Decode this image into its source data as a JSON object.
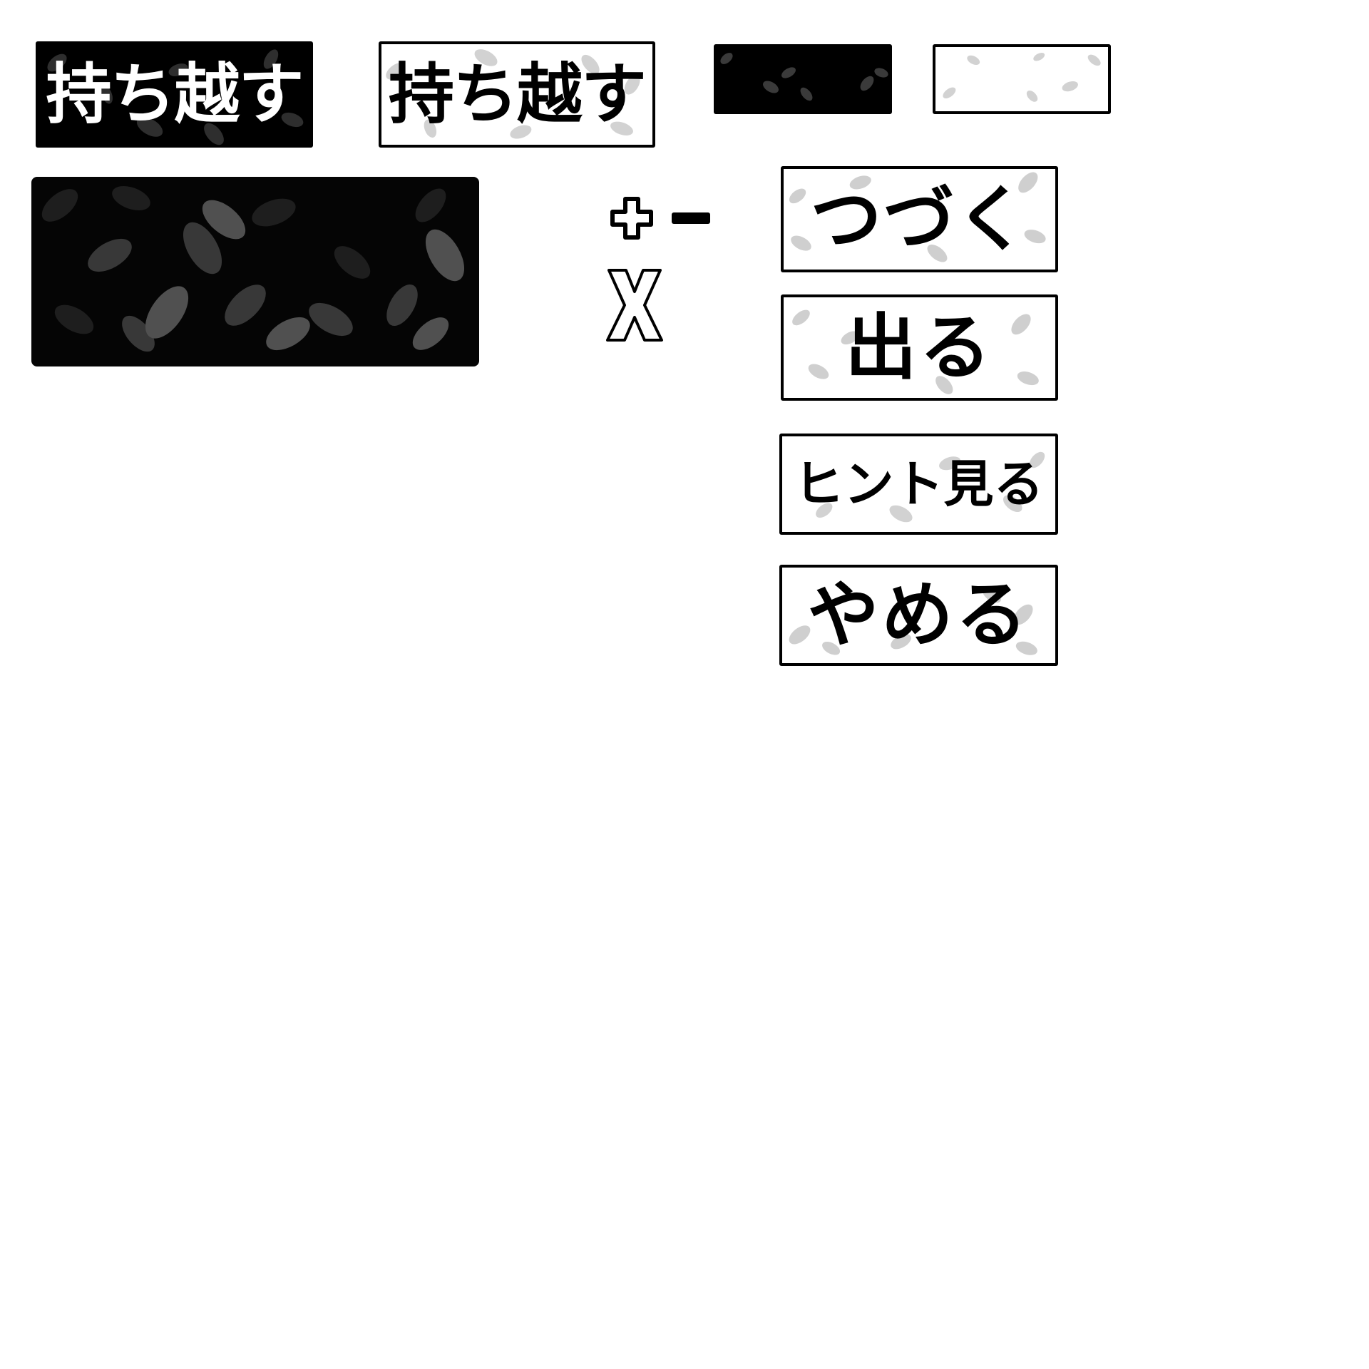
{
  "buttons": {
    "carry_over_dark": {
      "label": "持ち越す"
    },
    "carry_over_light": {
      "label": "持ち越す"
    },
    "continue": {
      "label": "つづく"
    },
    "exit": {
      "label": "出る"
    },
    "view_hint": {
      "label": "ヒント見る"
    },
    "quit": {
      "label": "やめる"
    }
  },
  "icons": {
    "plus": "plus-icon",
    "minus": "minus-icon",
    "close": "close-icon"
  },
  "colors": {
    "dark_fill": "#000000",
    "light_fill": "#ffffff",
    "border": "#000000",
    "leaf_on_light": "#cccccc",
    "leaf_on_dark": "#3a3a3a"
  }
}
